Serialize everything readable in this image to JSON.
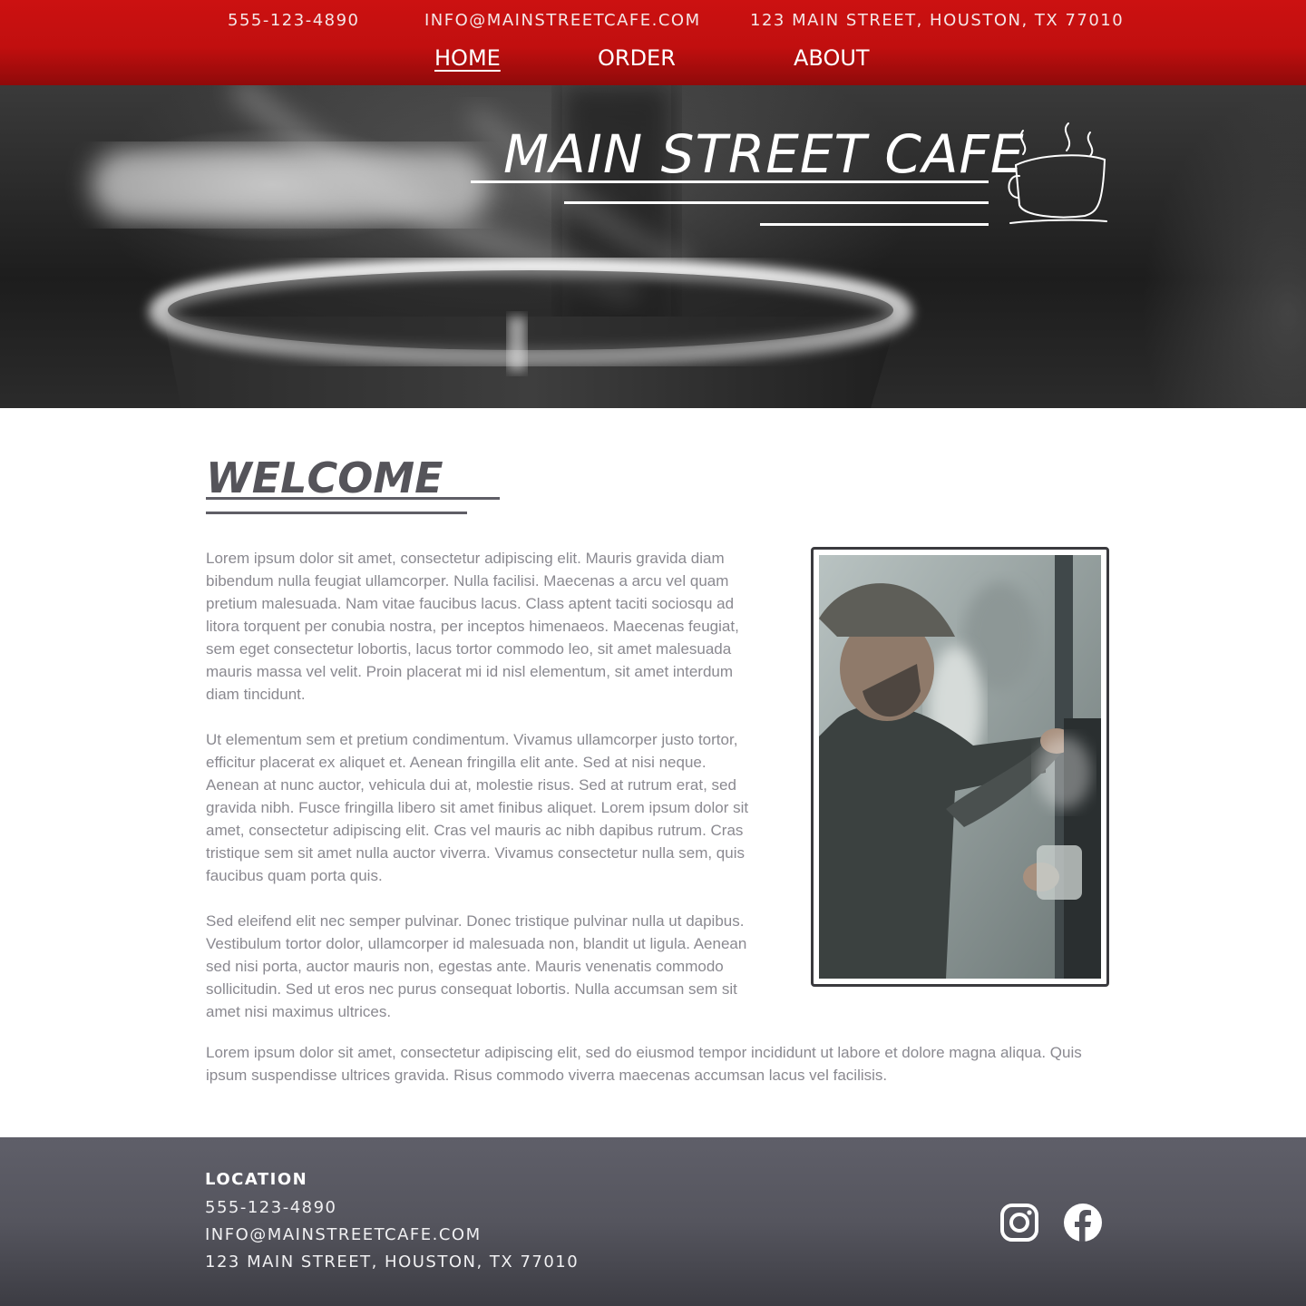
{
  "header": {
    "phone": "555-123-4890",
    "email": "INFO@MAINSTREETCAFE.COM",
    "address": "123 MAIN STREET, HOUSTON, TX 77010",
    "nav": [
      {
        "label": "HOME",
        "active": true
      },
      {
        "label": "ORDER",
        "active": false
      },
      {
        "label": "ABOUT",
        "active": false
      }
    ],
    "brand_color": "#c41010"
  },
  "hero": {
    "title": "MAIN STREET CAFE",
    "icon": "coffee-cup-icon"
  },
  "welcome": {
    "title": "WELCOME",
    "paragraphs": [
      "Lorem ipsum dolor sit amet, consectetur adipiscing elit. Mauris gravida diam bibendum nulla feugiat ullamcorper. Nulla facilisi. Maecenas a arcu vel quam pretium malesuada. Nam vitae faucibus lacus. Class aptent taciti sociosqu ad litora torquent per conubia nostra, per inceptos himenaeos. Maecenas feugiat, sem eget consectetur lobortis, lacus tortor commodo leo, sit amet malesuada mauris massa vel velit. Proin placerat mi id nisl elementum, sit amet interdum diam tincidunt.",
      "Ut elementum sem et pretium condimentum. Vivamus ullamcorper justo tortor, efficitur placerat ex aliquet et. Aenean fringilla elit ante. Sed at nisi neque. Aenean at nunc auctor, vehicula dui at, molestie risus. Sed at rutrum erat, sed gravida nibh. Fusce fringilla libero sit amet finibus aliquet. Lorem ipsum dolor sit amet, consectetur adipiscing elit. Cras vel mauris ac nibh dapibus rutrum. Cras tristique sem sit amet nulla auctor viverra. Vivamus consectetur nulla sem, quis faucibus quam porta quis.",
      "Sed eleifend elit nec semper pulvinar. Donec tristique pulvinar nulla ut dapibus. Vestibulum tortor dolor, ullamcorper id malesuada non, blandit ut ligula. Aenean sed nisi porta, auctor mauris non, egestas ante. Mauris venenatis commodo sollicitudin. Sed ut eros nec purus consequat lobortis. Nulla accumsan sem sit amet nisi maximus ultrices."
    ],
    "wide_paragraph": "Lorem ipsum dolor sit amet, consectetur adipiscing elit, sed do eiusmod tempor incididunt ut labore et dolore magna aliqua. Quis ipsum suspendisse ultrices gravida. Risus commodo viverra maecenas accumsan lacus vel facilisis."
  },
  "footer": {
    "heading": "LOCATION",
    "phone": "555-123-4890",
    "email": "INFO@MAINSTREETCAFE.COM",
    "address": "123 MAIN STREET, HOUSTON, TX 77010",
    "social": [
      {
        "icon": "instagram-icon"
      },
      {
        "icon": "facebook-icon"
      }
    ]
  }
}
